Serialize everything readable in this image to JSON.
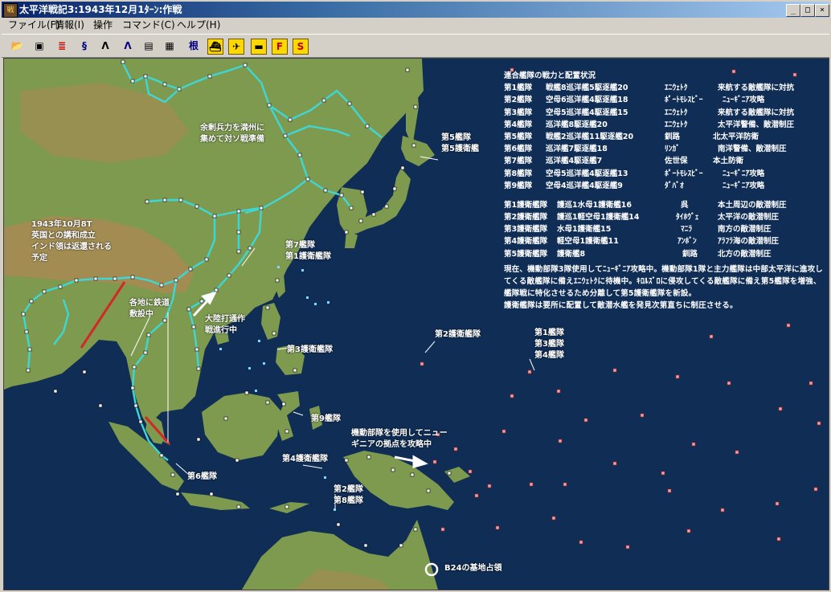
{
  "window": {
    "title": "太平洋戦記3:1943年12月1ﾀｰﾝ:作戦",
    "app_icon": "戦",
    "buttons": {
      "minimize": "_",
      "maximize": "□",
      "close": "×"
    }
  },
  "menu": [
    {
      "label": "ファイル(F)"
    },
    {
      "label": "情報(I)"
    },
    {
      "label": "操作"
    },
    {
      "label": "コマンド(C)"
    },
    {
      "label": "ヘルプ(H)"
    }
  ],
  "toolbar": [
    {
      "icon": "open-folder-icon",
      "glyph": "📂"
    },
    {
      "icon": "save-disk-icon",
      "glyph": "▣"
    },
    {
      "icon": "fleet-status-icon",
      "glyph": "≣"
    },
    {
      "icon": "supply-status-icon",
      "glyph": "§"
    },
    {
      "icon": "army-icon",
      "glyph": "ᐱ"
    },
    {
      "icon": "air-unit-icon",
      "glyph": "ᐱ"
    },
    {
      "icon": "report-icon",
      "glyph": "▤"
    },
    {
      "icon": "calendar-icon",
      "glyph": "▦"
    },
    {
      "icon": "base-icon",
      "glyph": "根"
    },
    {
      "icon": "ship-icon",
      "glyph": "⛴"
    },
    {
      "icon": "plane-icon",
      "glyph": "✈"
    },
    {
      "icon": "tank-icon",
      "glyph": "▬"
    },
    {
      "icon": "fleet-f-icon",
      "glyph": "F"
    },
    {
      "icon": "strategy-s-icon",
      "glyph": "S"
    }
  ],
  "map": {
    "colors": {
      "sea": "#0f2d55",
      "rail": "#3fd6d6",
      "land": "#7d9a4e",
      "highland": "#a88a54",
      "marker_red": "#e15a3c"
    },
    "annotations": [
      {
        "id": "manchuria-note",
        "lines": [
          "余剰兵力を満州に",
          "集めて対ソ戦準備"
        ]
      },
      {
        "id": "india-note",
        "lines": [
          "1943年10月8T",
          "英国との講和成立",
          "インド領は返還される",
          "予定"
        ]
      },
      {
        "id": "rail-note",
        "lines": [
          "各地に鉄道",
          "敷設中"
        ]
      },
      {
        "id": "continent-note",
        "lines": [
          "大陸打通作",
          "戦進行中"
        ]
      },
      {
        "id": "newguinea-note",
        "lines": [
          "機動部隊を使用してニュー",
          "ギニアの拠点を攻略中"
        ]
      },
      {
        "id": "b24-note",
        "lines": [
          "B24の基地占領"
        ]
      }
    ],
    "fleet_labels": [
      {
        "id": "fleet5-north",
        "lines": [
          "第5艦隊",
          "第5護衛艦"
        ]
      },
      {
        "id": "fleet7-escort1",
        "lines": [
          "第7艦隊",
          "第1護衛艦隊"
        ]
      },
      {
        "id": "escort3",
        "lines": [
          "第3護衛艦隊"
        ]
      },
      {
        "id": "escort2",
        "lines": [
          "第2護衛艦隊"
        ]
      },
      {
        "id": "fleet1-3-4",
        "lines": [
          "第1艦隊",
          "第3艦隊",
          "第4艦隊"
        ]
      },
      {
        "id": "escort9",
        "lines": [
          "第9艦隊"
        ]
      },
      {
        "id": "escort4",
        "lines": [
          "第4護衛艦隊"
        ]
      },
      {
        "id": "fleet6",
        "lines": [
          "第6艦隊"
        ]
      },
      {
        "id": "fleet2-8",
        "lines": [
          "第2艦隊",
          "第8艦隊"
        ]
      }
    ]
  },
  "status_panel": {
    "title": "連合艦隊の戦力と配置状況",
    "fleets": [
      {
        "name": "第1艦隊",
        "composition": "戦艦8巡洋艦5駆逐艦20",
        "location": "ｴﾆｳｪﾄｸ",
        "mission": "来航する敵艦隊に対抗"
      },
      {
        "name": "第2艦隊",
        "composition": "空母6巡洋艦4駆逐艦18",
        "location": "ﾎﾟｰﾄﾓﾚｽﾋﾞｰ",
        "mission": "ﾆｭｰｷﾞﾆｱ攻略"
      },
      {
        "name": "第3艦隊",
        "composition": "空母5巡洋艦4駆逐艦15",
        "location": "ｴﾆｳｪﾄｸ",
        "mission": "来航する敵艦隊に対抗"
      },
      {
        "name": "第4艦隊",
        "composition": "巡洋艦8駆逐艦20",
        "location": "ｴﾆｳｪﾄｸ",
        "mission": "太平洋警備、敵潜制圧"
      },
      {
        "name": "第5艦隊",
        "composition": "戦艦2巡洋艦11駆逐艦20",
        "location": "釧路",
        "mission": "北太平洋防衛"
      },
      {
        "name": "第6艦隊",
        "composition": "巡洋艦7駆逐艦18",
        "location": "ﾘﾝｶﾞ",
        "mission": "南洋警備、敵潜制圧"
      },
      {
        "name": "第7艦隊",
        "composition": "巡洋艦4駆逐艦7",
        "location": "佐世保",
        "mission": "本土防衛"
      },
      {
        "name": "第8艦隊",
        "composition": "空母5巡洋艦4駆逐艦13",
        "location": "ﾎﾟｰﾄﾓﾚｽﾋﾞｰ",
        "mission": "ﾆｭｰｷﾞﾆｱ攻略"
      },
      {
        "name": "第9艦隊",
        "composition": "空母4巡洋艦4駆逐艦9",
        "location": "ﾀﾞﾊﾞｵ",
        "mission": "ﾆｭｰｷﾞﾆｱ攻略"
      }
    ],
    "escorts": [
      {
        "name": "第1護衛艦隊",
        "composition": "護巡1水母1護衛艦16",
        "location": "呉",
        "mission": "本土周辺の敵潜制圧"
      },
      {
        "name": "第2護衛艦隊",
        "composition": "護巡1軽空母1護衛艦14",
        "location": "ﾀｲﾎｳﾞｪ",
        "mission": "太平洋の敵潜制圧"
      },
      {
        "name": "第3護衛艦隊",
        "composition": "水母1護衛艦15",
        "location": "ﾏﾆﾗ",
        "mission": "南方の敵潜制圧"
      },
      {
        "name": "第4護衛艦隊",
        "composition": "軽空母1護衛艦11",
        "location": "ｱﾝﾎﾞﾝ",
        "mission": "ｱﾗﾌﾗ海の敵潜制圧"
      },
      {
        "name": "第5護衛艦隊",
        "composition": "護衛艦8",
        "location": "釧路",
        "mission": "北方の敵潜制圧"
      }
    ],
    "summary": "現在、機動部隊3隊使用してﾆｭｰｷﾞﾆｱ攻略中。機動部隊1隊と主力艦隊は中部太平洋に進攻してくる敵艦隊に備えｴﾆｳｪﾄｸに待機中。ｷﾛﾙｽﾞﾛに侵攻してくる敵艦隊に備え第5艦隊を増強、艦隊戦に特化させるため分離して第5護衛艦隊を新設。",
    "note": "護衛艦隊は要所に配置して敵潜水艦を発見次第直ちに制圧させる。"
  }
}
